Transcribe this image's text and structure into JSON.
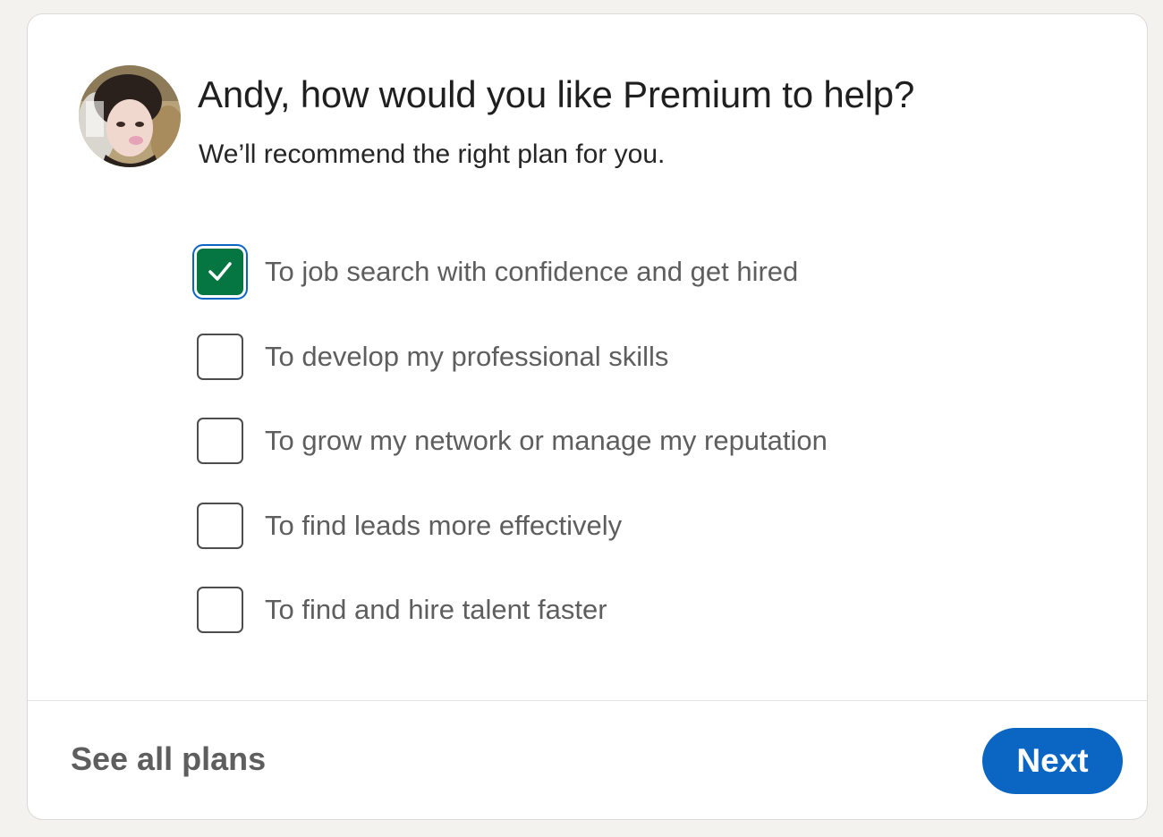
{
  "header": {
    "title": "Andy, how would you like Premium to help?",
    "subtitle": "We’ll recommend the right plan for you."
  },
  "options": [
    {
      "label": "To job search with confidence and get hired",
      "checked": true
    },
    {
      "label": "To develop my professional skills",
      "checked": false
    },
    {
      "label": "To grow my network or manage my reputation",
      "checked": false
    },
    {
      "label": "To find leads more effectively",
      "checked": false
    },
    {
      "label": "To find and hire talent faster",
      "checked": false
    }
  ],
  "footer": {
    "see_all_label": "See all plans",
    "next_label": "Next"
  },
  "colors": {
    "accent": "#0a66c2",
    "checkbox_checked": "#057642",
    "page_background": "#f3f2ef"
  }
}
